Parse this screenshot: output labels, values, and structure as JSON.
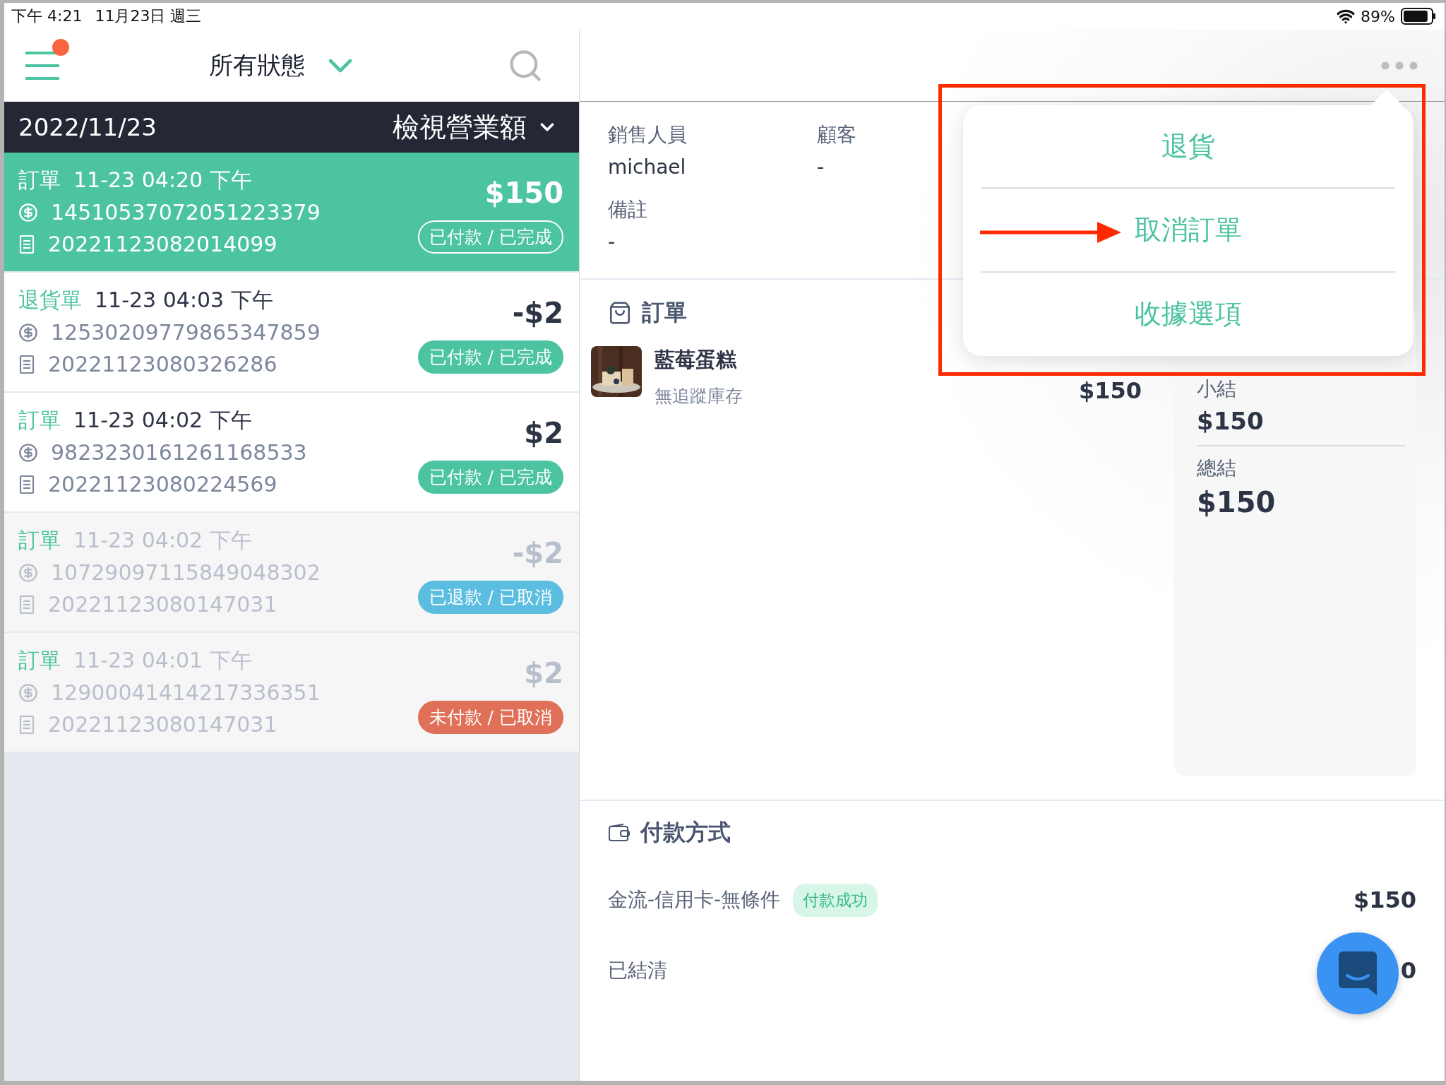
{
  "status_bar": {
    "time": "下午 4:21",
    "date": "11月23日 週三",
    "battery": "89%"
  },
  "list_header": {
    "filter": "所有狀態",
    "menu_badge": true
  },
  "date_bar": {
    "date": "2022/11/23",
    "action": "檢視營業額"
  },
  "orders": [
    {
      "type": "訂單",
      "time": "11-23 04:20 下午",
      "transaction_id": "14510537072051223379",
      "order_no": "20221123082014099",
      "amount": "$150",
      "status": "已付款 / 已完成",
      "color": "#4cc3a1",
      "selected": true,
      "dimmed": false
    },
    {
      "type": "退貨單",
      "time": "11-23 04:03 下午",
      "transaction_id": "12530209779865347859",
      "order_no": "20221123080326286",
      "amount": "-$2",
      "status": "已付款 / 已完成",
      "color": "#4cc3a1",
      "selected": false,
      "dimmed": false
    },
    {
      "type": "訂單",
      "time": "11-23 04:02 下午",
      "transaction_id": "9823230161261168533",
      "order_no": "20221123080224569",
      "amount": "$2",
      "status": "已付款 / 已完成",
      "color": "#4cc3a1",
      "selected": false,
      "dimmed": false
    },
    {
      "type": "訂單",
      "time": "11-23 04:02 下午",
      "transaction_id": "10729097115849048302",
      "order_no": "20221123080147031",
      "amount": "-$2",
      "status": "已退款 / 已取消",
      "color": "#5bbde0",
      "selected": false,
      "dimmed": true
    },
    {
      "type": "訂單",
      "time": "11-23 04:01 下午",
      "transaction_id": "12900041414217336351",
      "order_no": "20221123080147031",
      "amount": "$2",
      "status": "未付款 / 已取消",
      "color": "#e07058",
      "selected": false,
      "dimmed": true
    }
  ],
  "info": [
    {
      "label": "銷售人員",
      "value": "michael"
    },
    {
      "label": "顧客",
      "value": "-"
    },
    {
      "label": "備註",
      "value": "-"
    }
  ],
  "order_section": {
    "title": "訂單",
    "items": [
      {
        "name": "藍莓蛋糕",
        "note": "無追蹤庫存",
        "price": "$150"
      }
    ],
    "summary": [
      {
        "label": "小結",
        "value": "$150"
      },
      {
        "label": "總結",
        "value": "$150"
      }
    ]
  },
  "payment_section": {
    "title": "付款方式",
    "methods": [
      {
        "name": "金流-信用卡-無條件",
        "badge": "付款成功",
        "amount": "$150"
      }
    ],
    "settled": {
      "label": "已結清",
      "amount": "0"
    }
  },
  "menu": {
    "items": [
      {
        "label": "退貨",
        "marked": false
      },
      {
        "label": "取消訂單",
        "marked": true
      },
      {
        "label": "收據選項",
        "marked": false
      }
    ]
  }
}
